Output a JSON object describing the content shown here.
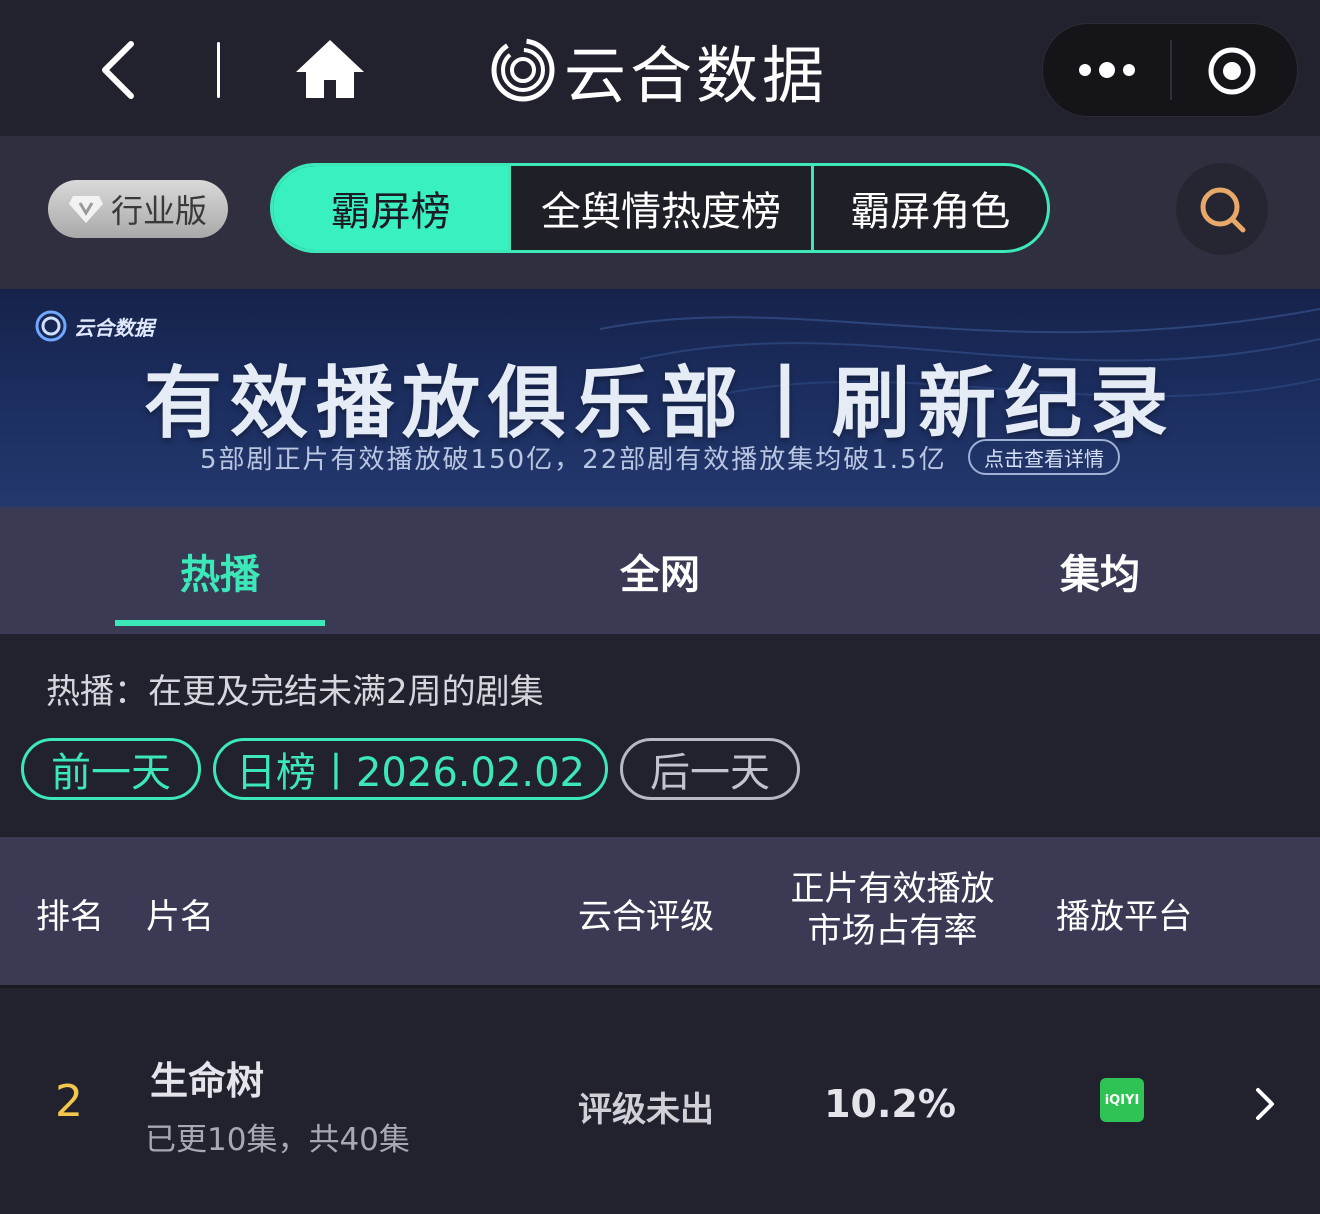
{
  "topbar": {
    "brand_name": "云合数据"
  },
  "segments": {
    "industry_badge": "行业版",
    "items": [
      {
        "label": "霸屏榜",
        "active": true
      },
      {
        "label": "全舆情热度榜",
        "active": false
      },
      {
        "label": "霸屏角色",
        "active": false
      }
    ]
  },
  "banner": {
    "logo_text": "云合数据",
    "title": "有效播放俱乐部丨刷新纪录",
    "subtitle": "5部剧正片有效播放破150亿，22部剧有效播放集均破1.5亿",
    "detail_button": "点击查看详情"
  },
  "tabs": [
    {
      "label": "热播",
      "active": true
    },
    {
      "label": "全网",
      "active": false
    },
    {
      "label": "集均",
      "active": false
    }
  ],
  "info": {
    "note": "热播：在更及完结未满2周的剧集"
  },
  "date_nav": {
    "prev": "前一天",
    "current": "日榜丨2026.02.02",
    "next": "后一天"
  },
  "table": {
    "headers": {
      "rank": "排名",
      "title": "片名",
      "rating": "云合评级",
      "share_line1": "正片有效播放",
      "share_line2": "市场占有率",
      "platform": "播放平台"
    },
    "rows": [
      {
        "rank": "2",
        "title": "生命树",
        "episodes": "已更10集，共40集",
        "rating": "评级未出",
        "share": "10.2%",
        "platform": "iQIYI"
      }
    ]
  },
  "colors": {
    "accent": "#3ce8b7",
    "rank": "#f1c84b",
    "platform_green": "#2fc254"
  }
}
